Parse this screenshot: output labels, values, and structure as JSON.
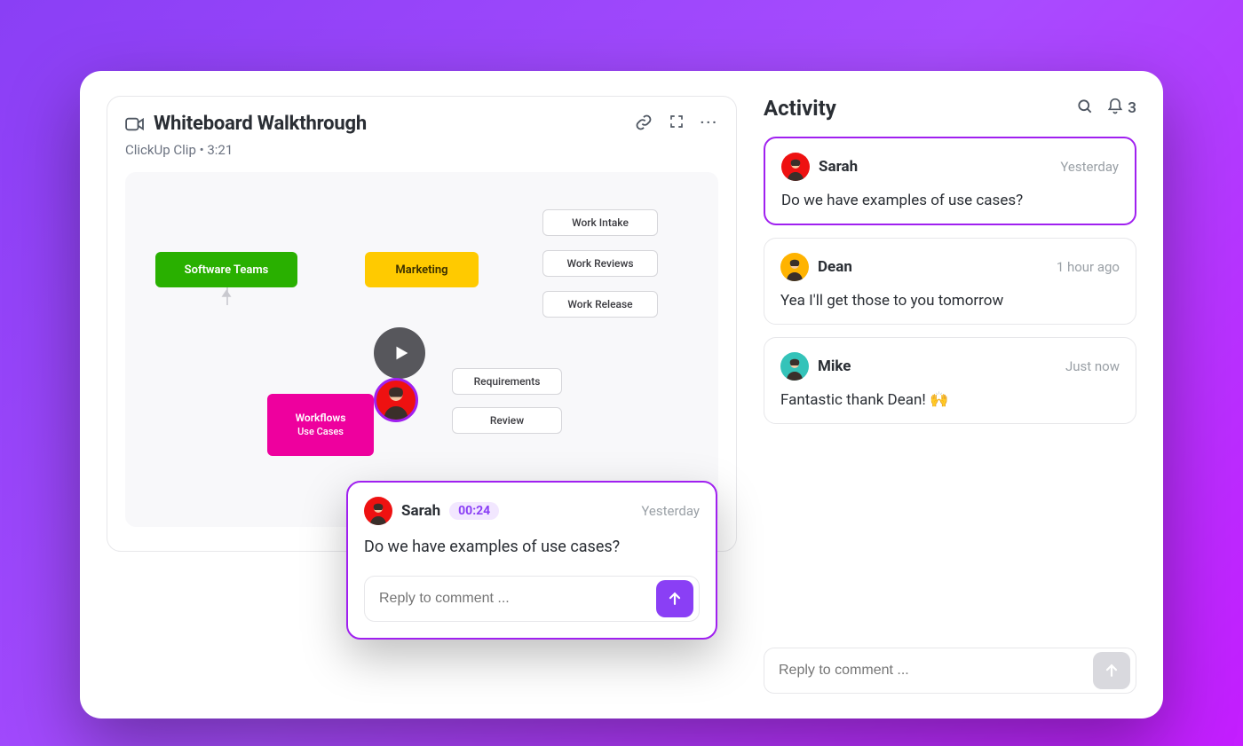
{
  "clip": {
    "title": "Whiteboard Walkthrough",
    "subtitle": "ClickUp Clip • 3:21",
    "nodes": {
      "software": "Software Teams",
      "marketing": "Marketing",
      "workflows": "Workflows",
      "usecases": "Use Cases",
      "work_intake": "Work Intake",
      "work_reviews": "Work Reviews",
      "work_release": "Work Release",
      "requirements": "Requirements",
      "review": "Review"
    }
  },
  "popup": {
    "name": "Sarah",
    "timestamp": "00:24",
    "date": "Yesterday",
    "text": "Do we have examples of use cases?",
    "reply_placeholder": "Reply to comment ..."
  },
  "activity": {
    "title": "Activity",
    "count": "3",
    "reply_placeholder": "Reply to comment ...",
    "items": [
      {
        "name": "Sarah",
        "date": "Yesterday",
        "text": "Do we have examples of use cases?"
      },
      {
        "name": "Dean",
        "date": "1 hour ago",
        "text": "Yea I'll get those to you tomorrow"
      },
      {
        "name": "Mike",
        "date": "Just now",
        "text": "Fantastic thank Dean! 🙌"
      }
    ]
  }
}
